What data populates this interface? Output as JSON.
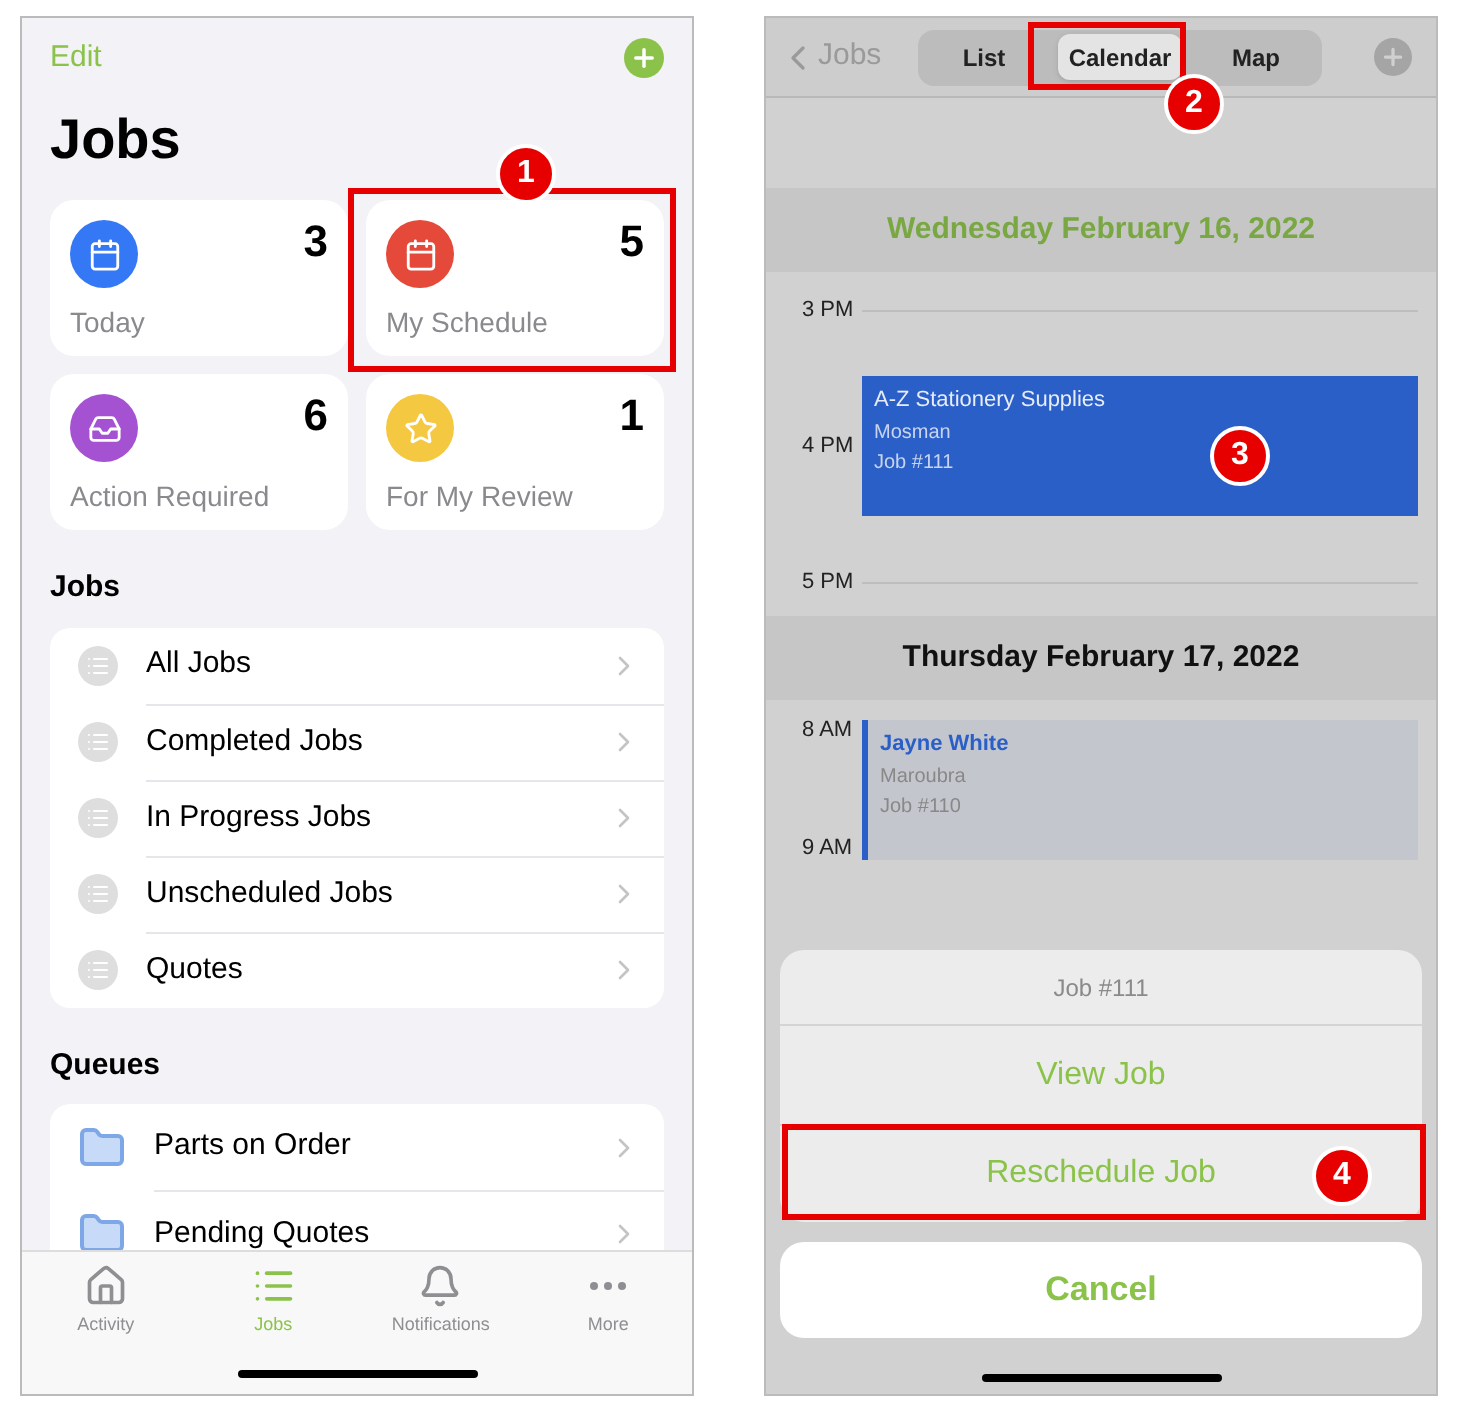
{
  "left_screen": {
    "edit": "Edit",
    "title": "Jobs",
    "summary_cards": [
      {
        "label": "Today",
        "count": "3",
        "color": "#3478f6"
      },
      {
        "label": "My Schedule",
        "count": "5",
        "color": "#e5493a"
      },
      {
        "label": "Action Required",
        "count": "6",
        "color": "#a452d2"
      },
      {
        "label": "For My Review",
        "count": "1",
        "color": "#f5c842"
      }
    ],
    "sections": [
      {
        "title": "Jobs",
        "items": [
          "All Jobs",
          "Completed Jobs",
          "In Progress Jobs",
          "Unscheduled Jobs",
          "Quotes"
        ]
      },
      {
        "title": "Queues",
        "items": [
          "Parts on Order",
          "Pending Quotes"
        ]
      }
    ],
    "tab_bar": [
      {
        "label": "Activity",
        "selected": false
      },
      {
        "label": "Jobs",
        "selected": true
      },
      {
        "label": "Notifications",
        "selected": false
      },
      {
        "label": "More",
        "selected": false
      }
    ]
  },
  "right_screen": {
    "back": "Jobs",
    "segments": [
      {
        "label": "List",
        "selected": false
      },
      {
        "label": "Calendar",
        "selected": true
      },
      {
        "label": "Map",
        "selected": false
      }
    ],
    "calendar": [
      {
        "kind": "day",
        "date": "Wednesday February 16, 2022",
        "today": true
      },
      {
        "kind": "time",
        "time": "3 PM"
      },
      {
        "kind": "event",
        "name": "A-Z Stationery Supplies",
        "suburb": "Mosman",
        "job": "Job #111",
        "selected": true,
        "times": [
          "4 PM"
        ]
      },
      {
        "kind": "time",
        "time": "5 PM"
      },
      {
        "kind": "day",
        "date": "Thursday February 17, 2022",
        "today": false
      },
      {
        "kind": "event",
        "name": "Jayne White",
        "suburb": "Maroubra",
        "job": "Job #110",
        "selected": false,
        "times": [
          "8 AM",
          "9 AM"
        ]
      }
    ],
    "action_sheet": {
      "title": "Job #111",
      "actions": [
        {
          "label": "View Job"
        },
        {
          "label": "Reschedule Job"
        }
      ],
      "cancel": "Cancel"
    }
  },
  "annotations": [
    {
      "number": "1",
      "boxed": true
    },
    {
      "number": "2",
      "boxed": true
    },
    {
      "number": "3",
      "boxed": false
    },
    {
      "number": "4",
      "boxed": true
    }
  ]
}
